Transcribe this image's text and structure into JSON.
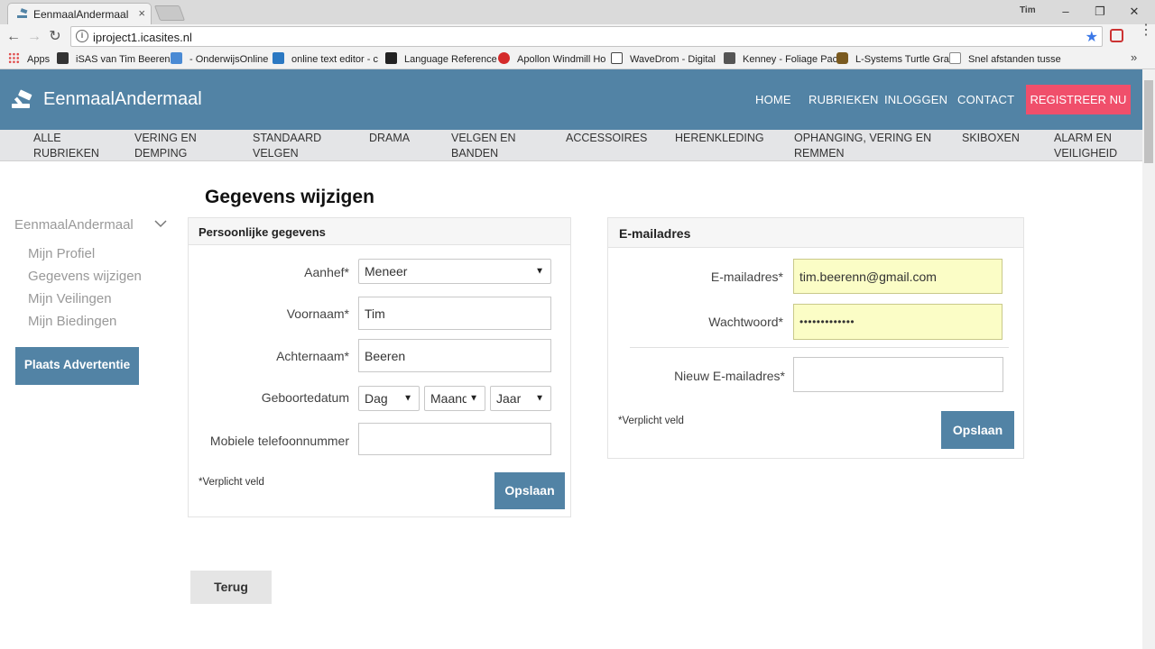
{
  "browser": {
    "tab_title": "EenmaalAndermaal",
    "tab_close": "×",
    "user_label": "Tim",
    "url": "iproject1.icasites.nl",
    "bookmarks": [
      {
        "label": "Apps",
        "color": "#e04848"
      },
      {
        "label": "iSAS van Tim Beeren",
        "color": "#333333"
      },
      {
        "label": "- OnderwijsOnline",
        "color": "#4a8ad4"
      },
      {
        "label": "online text editor - c",
        "color": "#2b78c2"
      },
      {
        "label": "Language Reference",
        "color": "#222222"
      },
      {
        "label": "Apollon Windmill Ho",
        "color": "#d42a2a"
      },
      {
        "label": "WaveDrom - Digital",
        "color": "#444444"
      },
      {
        "label": "Kenney - Foliage Pac",
        "color": "#555555"
      },
      {
        "label": "L-Systems Turtle Gra",
        "color": "#7a5a20"
      },
      {
        "label": "Snel afstanden tusse",
        "color": "#888888"
      }
    ],
    "bookmarks_more": "»"
  },
  "site": {
    "logo_text": "EenmaalAndermaal",
    "nav": [
      "HOME",
      "RUBRIEKEN",
      "INLOGGEN",
      "CONTACT"
    ],
    "register": "REGISTREER NU",
    "categories": [
      "ALLE RUBRIEKEN",
      "VERING EN DEMPING",
      "STANDAARD VELGEN",
      "DRAMA",
      "VELGEN EN BANDEN",
      "ACCESSOIRES",
      "HERENKLEDING",
      "OPHANGING, VERING EN REMMEN",
      "SKIBOXEN",
      "ALARM EN VEILIGHEID"
    ]
  },
  "sidebar": {
    "title": "EenmaalAndermaal",
    "links": [
      "Mijn Profiel",
      "Gegevens wijzigen",
      "Mijn Veilingen",
      "Mijn Biedingen"
    ],
    "cta": "Plaats Advertentie"
  },
  "main": {
    "title": "Gegevens wijzigen",
    "personal": {
      "heading": "Persoonlijke gegevens",
      "aanhef_label": "Aanhef*",
      "aanhef_value": "Meneer",
      "voornaam_label": "Voornaam*",
      "voornaam_value": "Tim",
      "achternaam_label": "Achternaam*",
      "achternaam_value": "Beeren",
      "geboortedatum_label": "Geboortedatum",
      "dag": "Dag",
      "maand": "Maand",
      "jaar": "Jaar",
      "mobiel_label": "Mobiele telefoonnummer",
      "mobiel_value": "",
      "required_note": "*Verplicht veld",
      "save": "Opslaan"
    },
    "email": {
      "heading": "E-mailadres",
      "email_label": "E-mailadres*",
      "email_value": "tim.beerenn@gmail.com",
      "password_label": "Wachtwoord*",
      "password_value": "•••••••••••••",
      "new_email_label": "Nieuw E-mailadres*",
      "new_email_value": "",
      "required_note": "*Verplicht veld",
      "save": "Opslaan"
    },
    "back": "Terug"
  },
  "colors": {
    "brand": "#5283a5",
    "register": "#f04f6b",
    "autofill": "#fbfdc6"
  }
}
